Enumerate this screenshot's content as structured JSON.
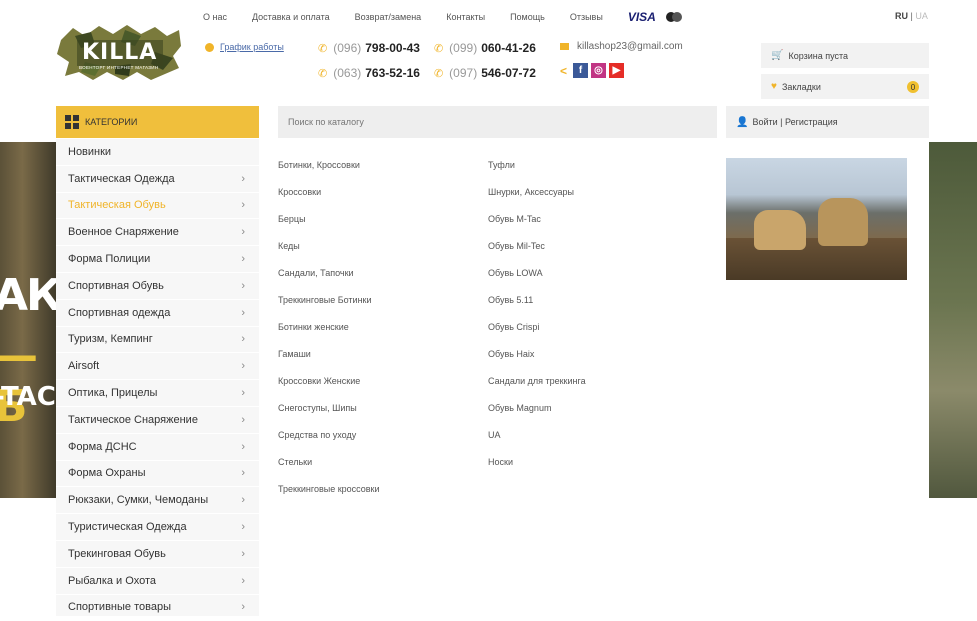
{
  "top_nav": [
    "О нас",
    "Доставка и оплата",
    "Возврат/замена",
    "Контакты",
    "Помощь",
    "Отзывы"
  ],
  "payment": {
    "visa": "VISA"
  },
  "lang": {
    "ru": "RU",
    "sep": "|",
    "ua": "UA"
  },
  "logo": {
    "title": "KILLA",
    "sub": "ВОЕНТОРГ ИНТЕРНЕТ МАГАЗИН"
  },
  "worktime": "График работы",
  "phones": [
    {
      "code": "(096)",
      "num": "798-00-43"
    },
    {
      "code": "(099)",
      "num": "060-41-26"
    },
    {
      "code": "(063)",
      "num": "763-52-16"
    },
    {
      "code": "(097)",
      "num": "546-07-72"
    }
  ],
  "email": "killashop23@gmail.com",
  "social": {
    "fb": "f",
    "ig": "◎",
    "yt": "▶"
  },
  "cart": "Корзина пуста",
  "bookmarks": {
    "label": "Закладки",
    "count": "0"
  },
  "categories_label": "КАТЕГОРИИ",
  "search_placeholder": "Поиск по каталогу",
  "login": "Войти | Регистрация",
  "sidebar": [
    {
      "label": "Новинки",
      "arrow": false
    },
    {
      "label": "Тактическая Одежда",
      "arrow": true
    },
    {
      "label": "Тактическая Обувь",
      "arrow": true,
      "active": true
    },
    {
      "label": "Военное Снаряжение",
      "arrow": true
    },
    {
      "label": "Форма Полиции",
      "arrow": true
    },
    {
      "label": "Спортивная Обувь",
      "arrow": true
    },
    {
      "label": "Спортивная одежда",
      "arrow": true
    },
    {
      "label": "Туризм, Кемпинг",
      "arrow": true
    },
    {
      "label": "Airsoft",
      "arrow": true
    },
    {
      "label": "Оптика, Прицелы",
      "arrow": true
    },
    {
      "label": "Тактическое Снаряжение",
      "arrow": true
    },
    {
      "label": "Форма ДСНС",
      "arrow": true
    },
    {
      "label": "Форма Охраны",
      "arrow": true
    },
    {
      "label": "Рюкзаки, Сумки, Чемоданы",
      "arrow": true
    },
    {
      "label": "Туристическая Одежда",
      "arrow": true
    },
    {
      "label": "Трекинговая Обувь",
      "arrow": true
    },
    {
      "label": "Рыбалка и Охота",
      "arrow": true
    },
    {
      "label": "Спортивные товары",
      "arrow": true
    }
  ],
  "col1": [
    "Ботинки, Кроссовки",
    "Кроссовки",
    "Берцы",
    "Кеды",
    "Сандали, Тапочки",
    "Треккинговые Ботинки",
    "Ботинки женские",
    "Гамаши",
    "Кроссовки Женские",
    "Снегоступы, Шипы",
    "Средства по уходу",
    "Стельки",
    "Треккинговые кроссовки"
  ],
  "col2": [
    "Туфли",
    "Шнурки, Аксессуары",
    "Обувь M-Tac",
    "Обувь Mil-Tec",
    "Обувь LOWA",
    "Обувь 5.11",
    "Обувь Crispi",
    "Обувь Haix",
    "Сандали для треккинга",
    "Обувь Magnum",
    "UA",
    "Носки"
  ],
  "banner": {
    "line1": "АКТ",
    "line2": "— Б",
    "line3": "-TAC"
  },
  "colors": {
    "accent": "#f0bf3c",
    "active_text": "#f0b429"
  }
}
